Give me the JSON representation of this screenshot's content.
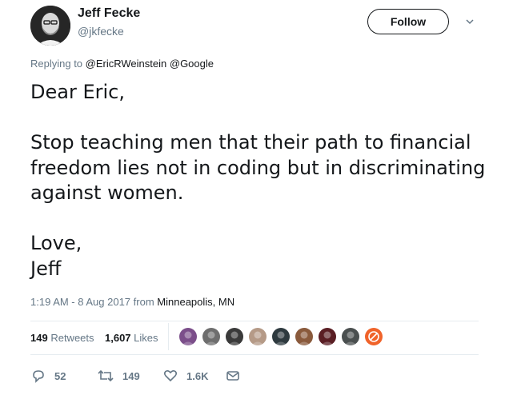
{
  "author": {
    "name": "Jeff Fecke",
    "handle": "@jkfecke"
  },
  "follow_label": "Follow",
  "reply": {
    "prefix": "Replying to ",
    "mentions": [
      "@EricRWeinstein",
      "@Google"
    ]
  },
  "tweet_text": "Dear Eric,\n\nStop teaching men that their path to financial freedom lies not in coding but in discriminating against women.\n\nLove,\nJeff",
  "meta": {
    "time": "1:19 AM - 8 Aug 2017",
    "from": " from ",
    "location": "Minneapolis, MN"
  },
  "stats": {
    "retweets_count": "149",
    "retweets_label": "Retweets",
    "likes_count": "1,607",
    "likes_label": "Likes"
  },
  "liker_avatars": [
    {
      "icon": "avatar-purple-icon",
      "color": "#7b4e8a"
    },
    {
      "icon": "avatar-gray-icon",
      "color": "#6e6e6e"
    },
    {
      "icon": "avatar-dark-icon",
      "color": "#3a3a3a"
    },
    {
      "icon": "avatar-face-icon",
      "color": "#b59a87"
    },
    {
      "icon": "avatar-earth-icon",
      "color": "#2e3a3f"
    },
    {
      "icon": "avatar-woman-icon",
      "color": "#8a5a3c"
    },
    {
      "icon": "avatar-red-icon",
      "color": "#5a1e24"
    },
    {
      "icon": "avatar-face2-icon",
      "color": "#4a4f4f"
    },
    {
      "icon": "avatar-orange-icon",
      "color": "#f0632a"
    }
  ],
  "actions": {
    "reply_count": "52",
    "retweet_count": "149",
    "like_count": "1.6K"
  },
  "colors": {
    "secondary_text": "#657786",
    "divider": "#e6ecf0"
  }
}
